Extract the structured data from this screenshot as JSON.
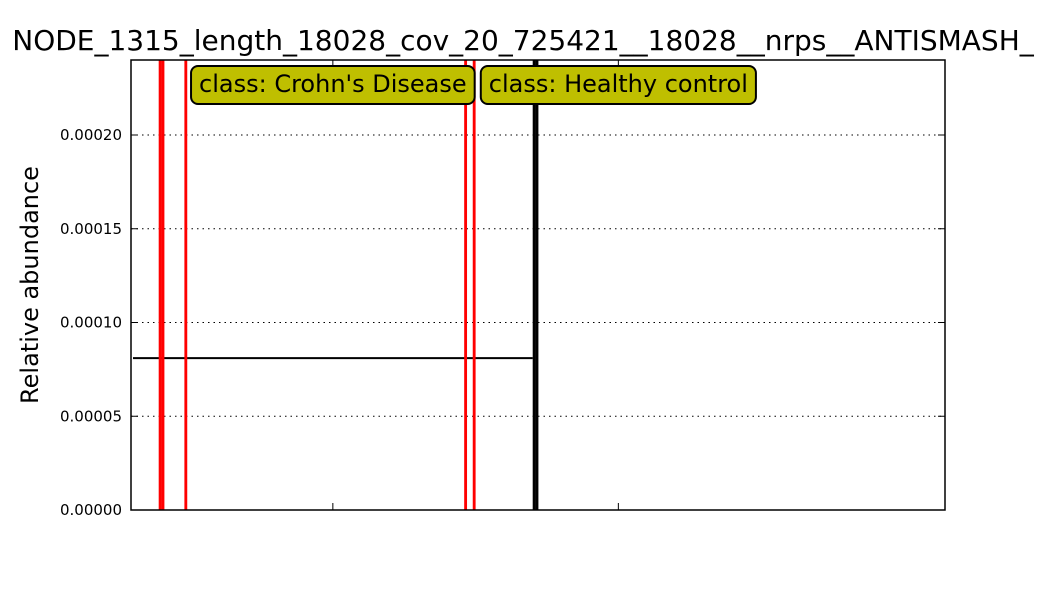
{
  "chart_data": {
    "type": "bar",
    "title": "NODE_1315_length_18028_cov_20_725421__18028__nrps__ANTISMASH_",
    "xlabel": "",
    "ylabel": "Relative abundance",
    "ylim": [
      0,
      0.00024
    ],
    "yticks": [
      "0.00000",
      "0.00005",
      "0.00010",
      "0.00015",
      "0.00020"
    ],
    "ytick_values": [
      0,
      5e-05,
      0.0001,
      0.00015,
      0.0002
    ],
    "grid": true,
    "sample_count": 200,
    "series": [
      {
        "class": "class: Crohn's Disease",
        "color": "#ff0000",
        "sample_range": [
          0,
          140
        ],
        "mean": 8.1e-05,
        "nonzero_samples": [
          {
            "index": 9,
            "value": 0.00024
          },
          {
            "index": 10,
            "value": 0.00024
          },
          {
            "index": 18,
            "value": 0.00024
          },
          {
            "index": 116,
            "value": 0.00024
          },
          {
            "index": 119,
            "value": 0.00024
          }
        ]
      },
      {
        "class": "class: Healthy control",
        "color": "#000000",
        "sample_range": [
          140,
          200
        ],
        "mean": 0,
        "nonzero_samples": [
          {
            "index": 140,
            "value": 0.00024
          },
          {
            "index": 141,
            "value": 0.00024
          }
        ]
      }
    ]
  }
}
